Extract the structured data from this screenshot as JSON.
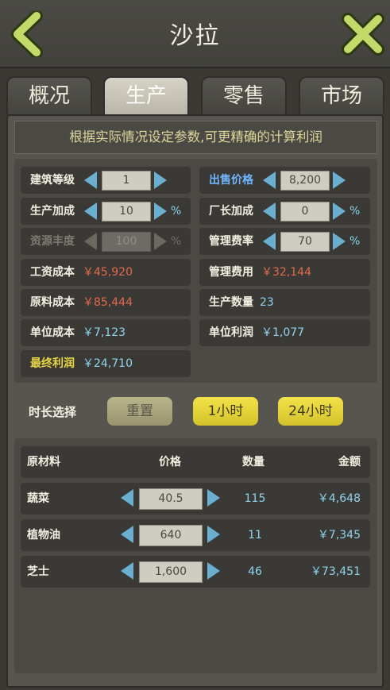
{
  "header": {
    "title": "沙拉"
  },
  "tabs": [
    {
      "label": "概况"
    },
    {
      "label": "生产"
    },
    {
      "label": "零售"
    },
    {
      "label": "市场"
    }
  ],
  "notice": "根据实际情况设定参数,可更精确的计算利润",
  "calc": {
    "building_level": {
      "label": "建筑等级",
      "value": "1"
    },
    "sale_price": {
      "label": "出售价格",
      "value": "8,200"
    },
    "production_bonus": {
      "label": "生产加成",
      "value": "10",
      "unit": "%"
    },
    "manager_bonus": {
      "label": "厂长加成",
      "value": "0",
      "unit": "%"
    },
    "resource_abundance": {
      "label": "资源丰度",
      "value": "100",
      "unit": "%"
    },
    "admin_rate": {
      "label": "管理费率",
      "value": "70",
      "unit": "%"
    },
    "wage_cost": {
      "label": "工资成本",
      "value": "￥45,920"
    },
    "admin_fee": {
      "label": "管理费用",
      "value": "￥32,144"
    },
    "material_cost": {
      "label": "原料成本",
      "value": "￥85,444"
    },
    "production_qty": {
      "label": "生产数量",
      "value": "23"
    },
    "unit_cost": {
      "label": "单位成本",
      "value": "￥7,123"
    },
    "unit_profit": {
      "label": "单位利润",
      "value": "￥1,077"
    },
    "final_profit": {
      "label": "最终利润",
      "value": "￥24,710"
    }
  },
  "duration": {
    "label": "时长选择",
    "reset": "重置",
    "h1": "1小时",
    "h24": "24小时"
  },
  "materials": {
    "headers": {
      "name": "原材料",
      "price": "价格",
      "qty": "数量",
      "amount": "金额"
    },
    "rows": [
      {
        "name": "蔬菜",
        "price": "40.5",
        "qty": "115",
        "amount": "￥4,648"
      },
      {
        "name": "植物油",
        "price": "640",
        "qty": "11",
        "amount": "￥7,345"
      },
      {
        "name": "芝士",
        "price": "1,600",
        "qty": "46",
        "amount": "￥73,451"
      }
    ]
  },
  "colors": {
    "accent_yellow": "#e7d545",
    "value_cyan": "#8fd4ec",
    "cost_red": "#e26a49",
    "label_blue": "#6fb6ff",
    "arrow_blue": "#6aaed0"
  },
  "icons": {
    "back": "chevron-left-icon",
    "close": "close-x-icon"
  }
}
